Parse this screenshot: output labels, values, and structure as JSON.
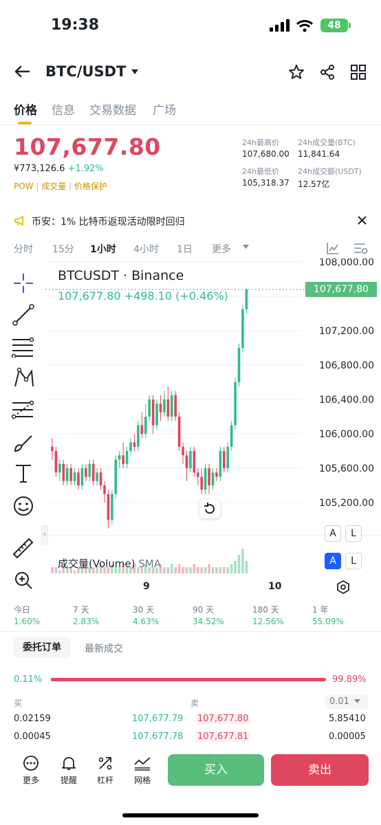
{
  "status_bar": {
    "time": "19:38",
    "battery": "48"
  },
  "header": {
    "pair": "BTC/USDT"
  },
  "tabs": [
    "价格",
    "信息",
    "交易数据",
    "广场"
  ],
  "ticker": {
    "price": "107,677.80",
    "cny": "¥773,126.6",
    "change": "+1.92%",
    "tags": [
      "POW",
      "成交量",
      "价格保护"
    ],
    "stats": [
      {
        "label": "24h最高价",
        "value": "107,680.00"
      },
      {
        "label": "24h成交量(BTC)",
        "value": "11,841.64"
      },
      {
        "label": "24h最低价",
        "value": "105,318.37"
      },
      {
        "label": "24h成交额(USDT)",
        "value": "12.57亿"
      }
    ]
  },
  "notice": {
    "text": "币安：1% 比特币返现活动限时回归"
  },
  "intervals": [
    "分时",
    "15分",
    "1小时",
    "4小时",
    "1日",
    "更多"
  ],
  "chart_header": {
    "title": "BTCUSDT · Binance",
    "price": "107,677.80",
    "change": "+498.10 (+0.46%)",
    "current_tag": "107,677.80",
    "volume_label": "成交量(Volume)",
    "volume_sma": "SMA"
  },
  "chart_data": {
    "type": "candlestick",
    "y_axis": [
      "108,000.00",
      "107,200.00",
      "106,800.00",
      "106,400.00",
      "106,000.00",
      "105,600.00",
      "105,200.00"
    ],
    "x_axis": [
      "9",
      "10"
    ],
    "ylim": [
      105000,
      108000
    ],
    "candles": [
      [
        105850,
        105800,
        105950,
        105700
      ],
      [
        105800,
        105550,
        105850,
        105500
      ],
      [
        105550,
        105650,
        105700,
        105450
      ],
      [
        105650,
        105450,
        105700,
        105400
      ],
      [
        105450,
        105600,
        105650,
        105400
      ],
      [
        105600,
        105450,
        105650,
        105400
      ],
      [
        105450,
        105550,
        105600,
        105400
      ],
      [
        105550,
        105400,
        105600,
        105350
      ],
      [
        105400,
        105600,
        105650,
        105350
      ],
      [
        105600,
        105500,
        105650,
        105450
      ],
      [
        105500,
        105650,
        105700,
        105450
      ],
      [
        105650,
        105450,
        105700,
        105400
      ],
      [
        105450,
        105550,
        105600,
        105400
      ],
      [
        105550,
        105400,
        105600,
        105350
      ],
      [
        105400,
        105300,
        105450,
        105200
      ],
      [
        105300,
        105000,
        105350,
        104900
      ],
      [
        105000,
        105300,
        105350,
        104950
      ],
      [
        105300,
        105700,
        105750,
        105250
      ],
      [
        105700,
        105750,
        105800,
        105600
      ],
      [
        105750,
        105650,
        105900,
        105600
      ],
      [
        105650,
        105800,
        105850,
        105600
      ],
      [
        105800,
        105900,
        105950,
        105750
      ],
      [
        105900,
        105850,
        106000,
        105800
      ],
      [
        105850,
        106100,
        106150,
        105800
      ],
      [
        106100,
        106000,
        106250,
        105950
      ],
      [
        106000,
        106200,
        106350,
        105950
      ],
      [
        106200,
        106400,
        106450,
        106150
      ],
      [
        106400,
        106100,
        106450,
        106000
      ],
      [
        106100,
        106350,
        106400,
        106050
      ],
      [
        106350,
        106250,
        106450,
        106150
      ],
      [
        106250,
        106400,
        106500,
        106200
      ],
      [
        106400,
        106200,
        106550,
        106150
      ],
      [
        106200,
        106450,
        106500,
        106150
      ],
      [
        106450,
        106200,
        106500,
        106150
      ],
      [
        106200,
        105850,
        106250,
        105800
      ],
      [
        105850,
        105750,
        105900,
        105650
      ],
      [
        105750,
        105600,
        105800,
        105450
      ],
      [
        105600,
        105800,
        105850,
        105550
      ],
      [
        105800,
        105550,
        105850,
        105500
      ],
      [
        105550,
        105500,
        105600,
        105400
      ],
      [
        105500,
        105350,
        105600,
        105300
      ],
      [
        105350,
        105600,
        105650,
        105300
      ],
      [
        105600,
        105400,
        105650,
        105300
      ],
      [
        105400,
        105550,
        105600,
        105350
      ],
      [
        105550,
        105500,
        105600,
        105450
      ],
      [
        105500,
        105800,
        105850,
        105450
      ],
      [
        105800,
        105600,
        105850,
        105550
      ],
      [
        105600,
        105850,
        105900,
        105550
      ],
      [
        105850,
        106100,
        106150,
        105800
      ],
      [
        106100,
        106600,
        106650,
        106050
      ],
      [
        106600,
        107000,
        107050,
        106550
      ],
      [
        107000,
        107450,
        107500,
        106950
      ],
      [
        107450,
        107680,
        107680,
        107400
      ]
    ],
    "volumes": [
      2,
      2,
      1,
      3,
      2,
      2,
      1,
      2,
      2,
      3,
      2,
      2,
      2,
      3,
      2,
      2,
      3,
      2,
      2,
      3,
      2,
      2,
      3,
      2,
      2,
      3,
      2,
      2,
      2,
      3,
      2,
      2,
      3,
      2,
      3,
      2,
      2,
      2,
      3,
      2,
      2,
      2,
      3,
      2,
      2,
      2,
      2,
      2,
      3,
      4,
      6,
      8,
      4
    ]
  },
  "chart_controls": {
    "auto": "A",
    "log": "L"
  },
  "performance": [
    {
      "label": "今日",
      "value": "1.60%"
    },
    {
      "label": "7 天",
      "value": "2.83%"
    },
    {
      "label": "30 天",
      "value": "4.63%"
    },
    {
      "label": "90 天",
      "value": "34.52%"
    },
    {
      "label": "180 天",
      "value": "12.56%"
    },
    {
      "label": "1 年",
      "value": "55.09%"
    }
  ],
  "order_tabs": [
    "委托订单",
    "最新成交"
  ],
  "order_ratio": {
    "buy": "0.11%",
    "sell": "99.89%",
    "buy_fraction": 0.0011
  },
  "order_book": {
    "buy_header": "买",
    "sell_header": "卖",
    "precision": "0.01",
    "rows": [
      {
        "buy_qty": "0.02159",
        "buy_price": "107,677.79",
        "sell_price": "107,677.80",
        "sell_qty": "5.85410"
      },
      {
        "buy_qty": "0.00045",
        "buy_price": "107,677.78",
        "sell_price": "107,677.81",
        "sell_qty": "0.00005"
      }
    ]
  },
  "bottom_nav": [
    "更多",
    "提醒",
    "杠杆",
    "网格"
  ],
  "actions": {
    "buy": "买入",
    "sell": "卖出"
  },
  "colors": {
    "up": "#2ebd85",
    "down": "#e0465e",
    "accent": "#f0b90b"
  }
}
